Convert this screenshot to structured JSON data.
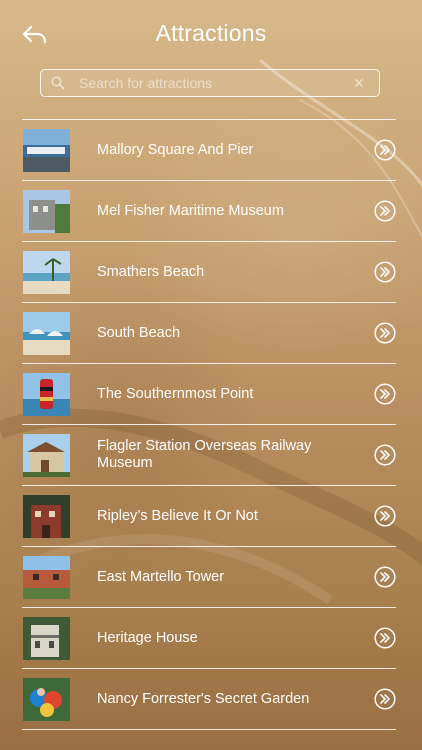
{
  "header": {
    "title": "Attractions",
    "back_icon": "back-arrow-icon"
  },
  "search": {
    "placeholder": "Search for attractions",
    "value": ""
  },
  "colors": {
    "text": "#ffffff",
    "divider": "#ffffff",
    "background_top": "#d7b98b",
    "background_bottom": "#9a6f43"
  },
  "attractions": [
    {
      "label": "Mallory Square And Pier",
      "thumb": "pier"
    },
    {
      "label": "Mel Fisher Maritime Museum",
      "thumb": "museum"
    },
    {
      "label": "Smathers Beach",
      "thumb": "beach"
    },
    {
      "label": "South Beach",
      "thumb": "umbrellas"
    },
    {
      "label": "The Southernmost Point",
      "thumb": "buoy"
    },
    {
      "label": "Flagler Station Overseas Railway Museum",
      "thumb": "station"
    },
    {
      "label": "Ripley’s Believe It Or Not",
      "thumb": "brick"
    },
    {
      "label": "East Martello Tower",
      "thumb": "tower"
    },
    {
      "label": "Heritage House",
      "thumb": "house"
    },
    {
      "label": "Nancy Forrester's Secret Garden",
      "thumb": "parrot"
    }
  ]
}
